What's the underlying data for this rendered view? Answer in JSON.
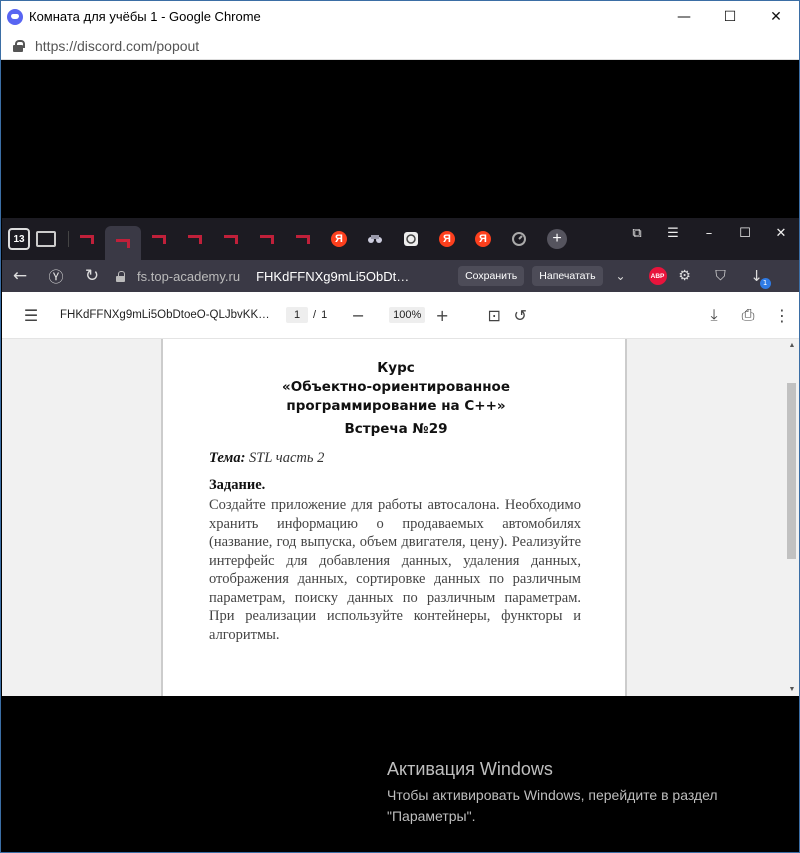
{
  "window": {
    "title": "Комната для учёбы 1 - Google Chrome",
    "url": "https://discord.com/popout",
    "controls": {
      "minimize": "—",
      "maximize": "☐",
      "close": "✕"
    }
  },
  "inner_browser": {
    "tab_count": "13",
    "tabs": [
      {
        "icon": "top-academy-favicon"
      },
      {
        "icon": "top-academy-favicon",
        "active": true
      },
      {
        "icon": "top-academy-favicon"
      },
      {
        "icon": "top-academy-favicon"
      },
      {
        "icon": "top-academy-favicon"
      },
      {
        "icon": "top-academy-favicon"
      },
      {
        "icon": "top-academy-favicon"
      },
      {
        "icon": "yandex-icon",
        "label": "Я"
      },
      {
        "icon": "extension-icon"
      },
      {
        "icon": "puzzle-icon"
      },
      {
        "icon": "yandex-icon",
        "label": "Я"
      },
      {
        "icon": "yandex-icon",
        "label": "Я"
      },
      {
        "icon": "timer-icon"
      }
    ],
    "address": {
      "domain": "fs.top-academy.ru",
      "title": "FHKdFFNXg9mLi5ObDt…",
      "save_label": "Сохранить",
      "print_label": "Напечатать",
      "abp_label": "ABP",
      "download_badge": "1"
    },
    "pdf_toolbar": {
      "filename": "FHKdFFNXg9mLi5ObDtoeO-QLJbvKK…",
      "page_current": "1",
      "page_total": "1",
      "zoom": "100%"
    },
    "document": {
      "heading1": "Курс",
      "heading2": "«Объектно-ориентированное",
      "heading3": "программирование на C++»",
      "meeting": "Встреча №29",
      "topic_label": "Тема:",
      "topic_value": "STL часть 2",
      "task_label": "Задание.",
      "task_text": "Создайте приложение для работы автосалона. Необходимо хранить информацию о продаваемых автомобилях (название, год выпуска, объем двигателя, цену). Реализуйте интерфейс для добавления данных, удаления данных, отображения данных, сортировке данных по различным параметрам, поиску данных по различным параметрам. При реализации используйте контейнеры, функторы и алгоритмы."
    }
  },
  "activation": {
    "title": "Активация Windows",
    "line1": "Чтобы активировать Windows, перейдите в раздел",
    "line2": "\"Параметры\"."
  }
}
